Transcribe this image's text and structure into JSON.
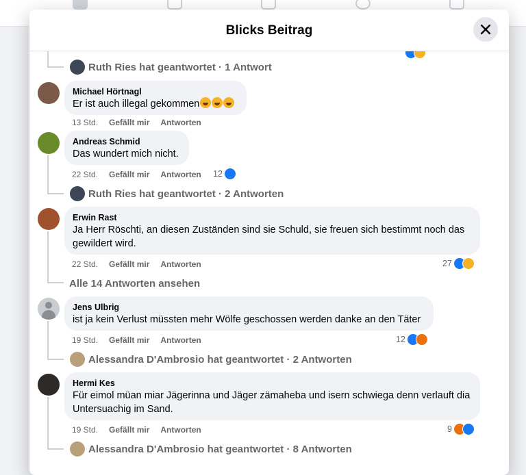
{
  "header": {
    "title": "Blicks Beitrag"
  },
  "thread_top": {
    "reply_line": "Ruth Ries hat geantwortet · 1 Antwort"
  },
  "comments": [
    {
      "author": "Michael Hörtnagl",
      "text": "Er ist auch illegal gekommen",
      "time": "13 Std.",
      "like": "Gefällt mir",
      "reply": "Antworten"
    },
    {
      "author": "Andreas Schmid",
      "text": "Das wundert mich nicht.",
      "time": "22 Std.",
      "like": "Gefällt mir",
      "reply": "Antworten",
      "reactions": "12",
      "reply_line": "Ruth Ries hat geantwortet · 2 Antworten"
    },
    {
      "author": "Erwin Rast",
      "text": "Ja Herr Röschti, an diesen Zuständen sind sie Schuld, sie freuen sich bestimmt noch das gewildert wird.",
      "time": "22 Std.",
      "like": "Gefällt mir",
      "reply": "Antworten",
      "reactions": "27",
      "reply_line": "Alle 14 Antworten ansehen"
    },
    {
      "author": "Jens Ulbrig",
      "text": "ist ja kein Verlust müssten mehr Wölfe geschossen werden danke an den Täter",
      "time": "19 Std.",
      "like": "Gefällt mir",
      "reply": "Antworten",
      "reactions": "12",
      "reply_line": "Alessandra D'Ambrosio hat geantwortet · 2 Antworten"
    },
    {
      "author": "Hermi Kes",
      "text": "Für eimol müan miar Jägerinna und Jäger zämaheba und isern schwiega denn verlauft dia Untersuachig im Sand.",
      "time": "19 Std.",
      "like": "Gefällt mir",
      "reply": "Antworten",
      "reactions": "9",
      "reply_line": "Alessandra D'Ambrosio hat geantwortet · 8 Antworten"
    }
  ],
  "icons": {
    "close": "close-icon",
    "like": "like-reaction-icon",
    "haha": "haha-reaction-icon",
    "angry": "angry-reaction-icon"
  }
}
